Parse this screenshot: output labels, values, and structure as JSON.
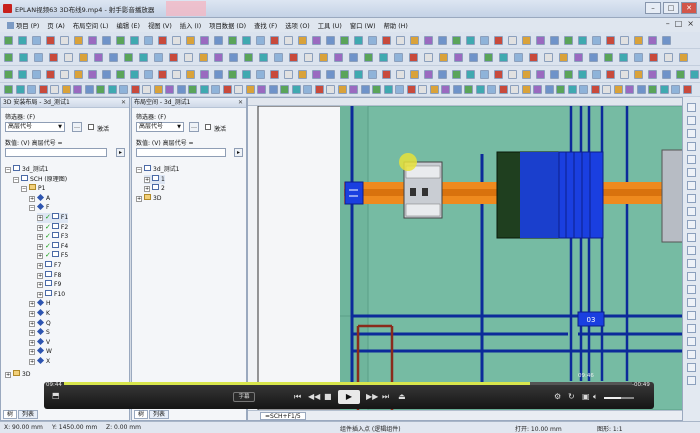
{
  "window": {
    "title": "EPLAN视频63 3D布线9.mp4 - 射手影音播放器",
    "buttons": [
      "–",
      "□",
      "✕"
    ]
  },
  "menu": {
    "items": [
      "项目 (P)",
      "页 (A)",
      "布局空间 (L)",
      "编辑 (E)",
      "视图 (V)",
      "插入 (I)",
      "项目数据 (D)",
      "查找 (F)",
      "选项 (O)",
      "工具 (U)",
      "窗口 (W)",
      "帮助 (H)"
    ],
    "right_controls": [
      "–",
      "□",
      "×"
    ]
  },
  "left_panel": {
    "title": "3D 安装布局 - 3d_测试1",
    "filter_label": "筛选器: (F)",
    "filter_value": "高层代号",
    "activate_label": "激活",
    "value_label": "数值: (V) 高层代号 =",
    "tree": [
      {
        "label": "3d_测试1",
        "level": 0,
        "icon": "page",
        "toggle": "−"
      },
      {
        "label": "SCH (原理图)",
        "level": 1,
        "icon": "page",
        "toggle": "−"
      },
      {
        "label": "P1",
        "level": 2,
        "icon": "folder",
        "toggle": "−"
      },
      {
        "label": "A",
        "level": 3,
        "icon": "diamond",
        "toggle": "+"
      },
      {
        "label": "F",
        "level": 3,
        "icon": "diamond",
        "toggle": "−"
      },
      {
        "label": "F1",
        "level": 4,
        "icon": "page",
        "toggle": "+",
        "check": true,
        "selected": true
      },
      {
        "label": "F2",
        "level": 4,
        "icon": "page",
        "toggle": "+",
        "check": true
      },
      {
        "label": "F3",
        "level": 4,
        "icon": "page",
        "toggle": "+",
        "check": true
      },
      {
        "label": "F4",
        "level": 4,
        "icon": "page",
        "toggle": "+",
        "check": true
      },
      {
        "label": "F5",
        "level": 4,
        "icon": "page",
        "toggle": "+",
        "check": true
      },
      {
        "label": "F7",
        "level": 4,
        "icon": "page",
        "toggle": "+"
      },
      {
        "label": "F8",
        "level": 4,
        "icon": "page",
        "toggle": "+"
      },
      {
        "label": "F9",
        "level": 4,
        "icon": "page",
        "toggle": "+"
      },
      {
        "label": "F10",
        "level": 4,
        "icon": "page",
        "toggle": "+"
      },
      {
        "label": "H",
        "level": 3,
        "icon": "diamond",
        "toggle": "+"
      },
      {
        "label": "K",
        "level": 3,
        "icon": "diamond",
        "toggle": "+"
      },
      {
        "label": "Q",
        "level": 3,
        "icon": "diamond",
        "toggle": "+"
      },
      {
        "label": "S",
        "level": 3,
        "icon": "diamond",
        "toggle": "+"
      },
      {
        "label": "V",
        "level": 3,
        "icon": "diamond",
        "toggle": "+"
      },
      {
        "label": "W",
        "level": 3,
        "icon": "diamond",
        "toggle": "+"
      },
      {
        "label": "X",
        "level": 3,
        "icon": "diamond",
        "toggle": "+"
      }
    ],
    "tree_bottom": {
      "label": "3D",
      "icon": "folder",
      "toggle": "+"
    },
    "tabs": [
      "树",
      "列表"
    ]
  },
  "mid_panel": {
    "title": "布局空间 - 3d_测试1",
    "filter_label": "筛选器: (F)",
    "filter_value": "高层代号",
    "activate_label": "激活",
    "value_label": "数值: (V) 高层代号 =",
    "tree": [
      {
        "label": "3d_测试1",
        "level": 0,
        "icon": "page",
        "toggle": "−"
      },
      {
        "label": "1",
        "level": 1,
        "icon": "page",
        "toggle": "+",
        "selected": true
      },
      {
        "label": "2",
        "level": 1,
        "icon": "page",
        "toggle": "+"
      },
      {
        "label": "3D",
        "level": 0,
        "icon": "folder",
        "toggle": "+"
      }
    ],
    "tabs": [
      "树",
      "列表"
    ]
  },
  "canvas": {
    "tab_label": "=SCH+F1/5",
    "labels": {
      "terminal_tag": "03"
    }
  },
  "statusbar": {
    "x": "X: 90.00 mm",
    "y": "Y: 1450.00 mm",
    "z": "Z: 0.00 mm",
    "hint": "组件插入点 (逻辑组件)",
    "grid": "打开: 10.00 mm",
    "scale": "图形: 1:1"
  },
  "player": {
    "time_elapsed": "09:44",
    "time_remaining": "-00:49",
    "seek_label": "09:46",
    "subtitle_button": "字幕",
    "progress": 0.82,
    "volume": 0.55
  }
}
